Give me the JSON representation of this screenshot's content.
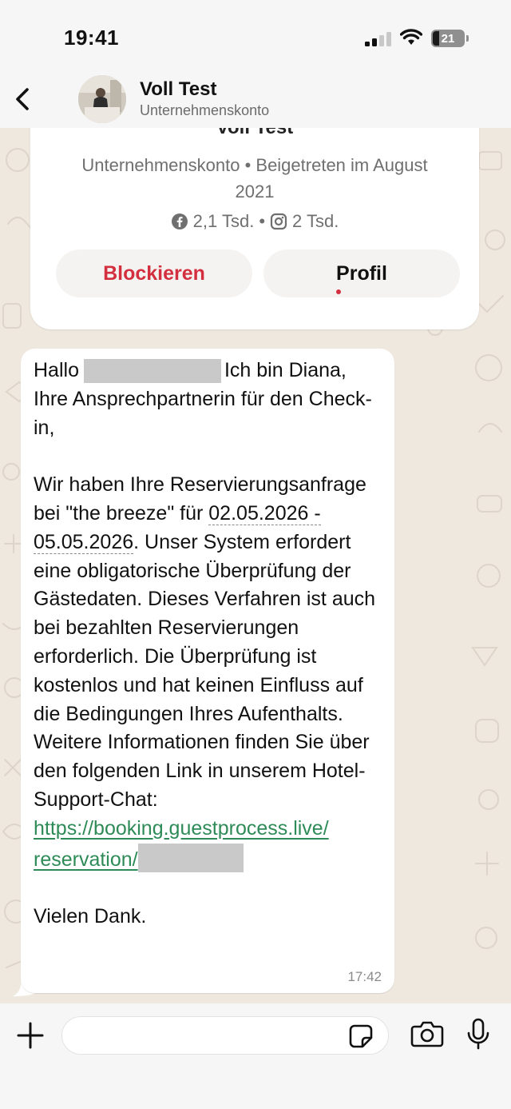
{
  "status_bar": {
    "time": "19:41",
    "battery": "21"
  },
  "header": {
    "name": "Voll Test",
    "subtitle": "Unternehmenskonto"
  },
  "profile_card": {
    "title": "Voll Test",
    "meta": "Unternehmenskonto • Beigetreten im August 2021",
    "facebook_count": "2,1 Tsd.",
    "separator": "•",
    "instagram_count": "2 Tsd.",
    "block_label": "Blockieren",
    "profile_label": "Profil"
  },
  "message": {
    "greeting": "Hallo",
    "line1_rest": "Ich bin Diana,",
    "line2": "Ihre Ansprechpartnerin für den Check-in,",
    "para2_start": "Wir haben Ihre Reservierungsanfrage bei \"the breeze\" für",
    "date_range": "02.05.2026 - 05.05.2026",
    "para2_rest": ". Unser System erfordert eine obligatorische Überprüfung der Gästedaten. Dieses Verfahren ist auch bei bezahlten Reservierungen erforderlich. Die Überprüfung ist kostenlos und hat keinen Einfluss auf die Bedingungen Ihres Aufenthalts. Weitere Informationen finden Sie über den folgenden Link in unserem Hotel-Support-Chat:",
    "link_line1": "https://booking.guestprocess.live/",
    "link_line2": "reservation/",
    "closing": "Vielen Dank.",
    "time": "17:42"
  },
  "icons": {
    "back": "chevron-left-icon",
    "signal": "cellular-signal-icon",
    "wifi": "wifi-icon",
    "facebook": "facebook-icon",
    "instagram": "instagram-icon",
    "plus": "plus-icon",
    "sticker": "sticker-icon",
    "camera": "camera-icon",
    "mic": "microphone-icon"
  },
  "colors": {
    "block_red": "#d32f3f",
    "link_green": "#2e8b57",
    "wallpaper": "#eee8df"
  }
}
